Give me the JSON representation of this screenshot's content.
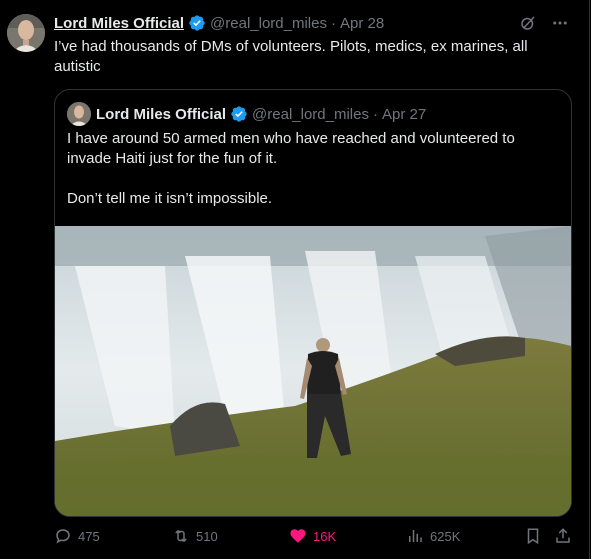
{
  "tweet": {
    "author_name": "Lord Miles Official",
    "handle": "@real_lord_miles",
    "date": "Apr 28",
    "sep": "·",
    "text": "I’ve had thousands of DMs of volunteers. Pilots, medics, ex marines, all autistic",
    "top_icons": [
      "grok-icon",
      "more-icon"
    ]
  },
  "quote": {
    "author_name": "Lord Miles Official",
    "handle": "@real_lord_miles",
    "date": "Apr 27",
    "sep": "·",
    "paragraph1": "I have around 50 armed men who have reached and volunteered to invade Haiti just for the fun of it.",
    "paragraph2": "Don’t tell me it isn’t impossible."
  },
  "actions": {
    "replies": "475",
    "reposts": "510",
    "likes": "16K",
    "views": "625K",
    "like_color": "#f91880"
  },
  "colors": {
    "background": "#000000",
    "text": "#e7e9ea",
    "muted": "#71767b",
    "verified": "#1d9bf0",
    "border": "#2f3336"
  }
}
